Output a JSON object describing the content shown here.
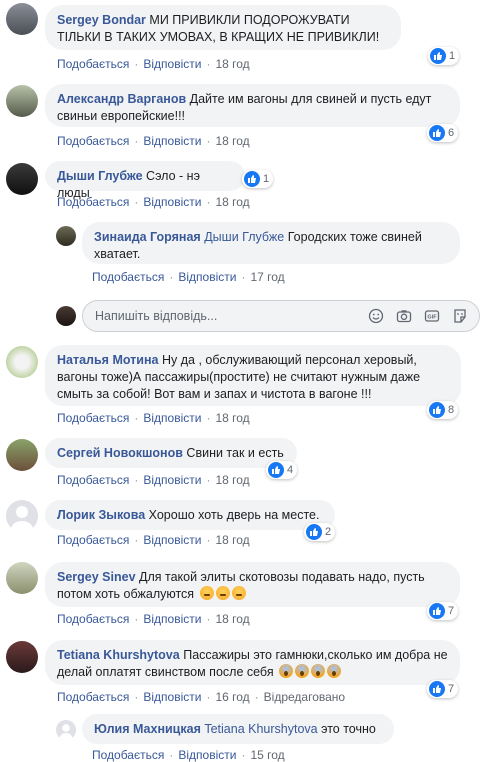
{
  "actions": {
    "like": "Подобається",
    "reply": "Відповісти",
    "edited": "Відредаговано"
  },
  "reply_box": {
    "placeholder": "Напишіть відповідь..."
  },
  "comments": [
    {
      "author": "Sergey Bondar",
      "text": "МИ ПРИВИКЛИ ПОДОРОЖУВАТИ ТІЛЬКИ В ТАКИХ УМОВАХ, В КРАЩИХ НЕ ПРИВИКЛИ!",
      "time": "18 год",
      "likes": "1"
    },
    {
      "author": "Александр Варганов",
      "text": "Дайте им вагоны для свиней и пусть едут свиньи европейские!!!",
      "time": "18 год",
      "likes": "6"
    },
    {
      "author": "Дыши Глубже",
      "text": "Сэло - нэ люды",
      "time": "18 год",
      "likes": "1"
    },
    {
      "author": "Зинаида Горяная",
      "mention": "Дыши Глубже",
      "text": "Городских тоже свиней хватает.",
      "time": "17 год"
    },
    {
      "author": "Наталья Мотина",
      "text": "Ну да , обслуживающий персонал херовый, вагоны тоже)А пассажиры(простите) не считают нужным даже смыть за собой! Вот вам и запах и чистота в вагоне !!!",
      "time": "18 год",
      "likes": "8"
    },
    {
      "author": "Сергей Новокшонов",
      "text": "Свини так и есть",
      "time": "18 год",
      "likes": "4"
    },
    {
      "author": "Лорик Зыкова",
      "text": "Хорошо хоть дверь на месте.",
      "time": "18 год",
      "likes": "2"
    },
    {
      "author": "Sergey Sinev",
      "text": "Для такой элиты скотовозы подавать надо, пусть потом хоть обжалуются",
      "time": "18 год",
      "likes": "7"
    },
    {
      "author": "Tetiana Khurshytova",
      "text": "Пассажиры это гамнюки,сколько им добра не делай оплатят свинством после себя",
      "time": "16 год",
      "likes": "7"
    },
    {
      "author": "Юлия Махницкая",
      "mention": "Tetiana Khurshytova",
      "text": "это точно",
      "time": "15 год"
    }
  ]
}
